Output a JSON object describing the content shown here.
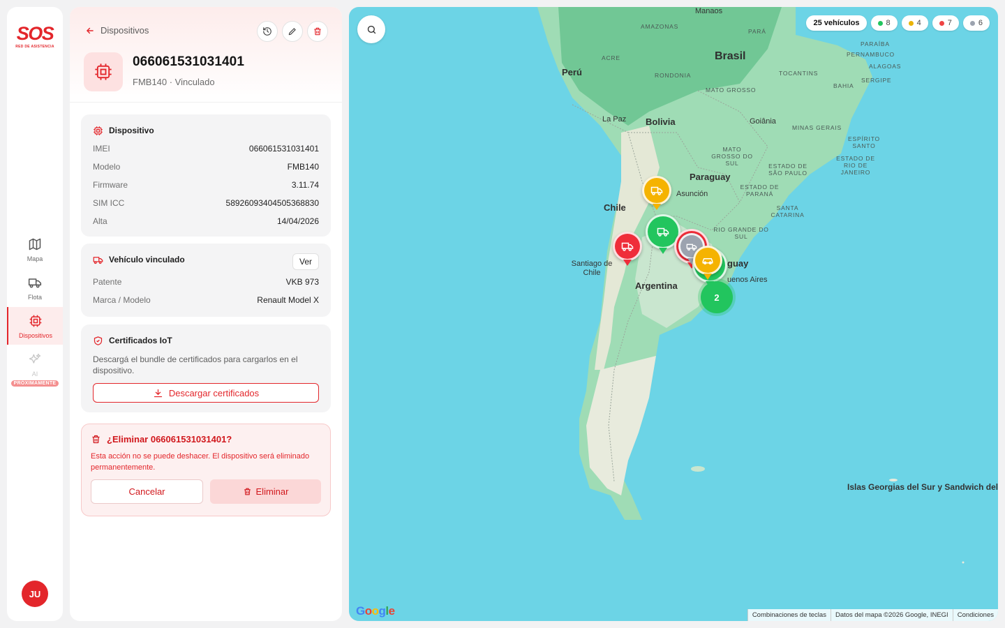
{
  "nav": {
    "logo": "SOS",
    "logo_sub": "RED DE ASISTENCIA",
    "items": [
      {
        "label": "Mapa"
      },
      {
        "label": "Flota"
      },
      {
        "label": "Dispositivos"
      },
      {
        "label": "AI",
        "badge": "PRÓXIMAMENTE"
      }
    ],
    "avatar": "JU"
  },
  "panel": {
    "back_label": "Dispositivos",
    "title": "066061531031401",
    "subtitle": "FMB140 · Vinculado",
    "device_card": {
      "title": "Dispositivo",
      "rows": [
        {
          "k": "IMEI",
          "v": "066061531031401"
        },
        {
          "k": "Modelo",
          "v": "FMB140"
        },
        {
          "k": "Firmware",
          "v": "3.11.74"
        },
        {
          "k": "SIM ICC",
          "v": "58926093404505368830"
        },
        {
          "k": "Alta",
          "v": "14/04/2026"
        }
      ]
    },
    "vehicle_card": {
      "title": "Vehículo vinculado",
      "button": "Ver",
      "rows": [
        {
          "k": "Patente",
          "v": "VKB 973"
        },
        {
          "k": "Marca / Modelo",
          "v": "Renault Model X"
        }
      ]
    },
    "cert_card": {
      "title": "Certificados IoT",
      "text": "Descargá el bundle de certificados para cargarlos en el dispositivo.",
      "button": "Descargar certificados"
    },
    "delete_confirm": {
      "title": "¿Eliminar 066061531031401?",
      "text": "Esta acción no se puede deshacer. El dispositivo será eliminado permanentemente.",
      "cancel": "Cancelar",
      "confirm": "Eliminar"
    }
  },
  "map": {
    "legend": {
      "total": "25 vehículos",
      "counts": [
        {
          "value": "8",
          "color": "#22c55e"
        },
        {
          "value": "4",
          "color": "#eab308"
        },
        {
          "value": "7",
          "color": "#ef4444"
        },
        {
          "value": "6",
          "color": "#9ca3af"
        }
      ]
    },
    "cluster_count": "2",
    "labels": {
      "manaos": "Manaos",
      "amazonas": "AMAZONAS",
      "para": "PARÁ",
      "paraiba": "PARAÍBA",
      "pernambuco": "PERNAMBUCO",
      "alagoas": "ALAGOAS",
      "sergipe": "SERGIPE",
      "bahia": "BAHIA",
      "acre": "ACRE",
      "brasil": "Brasil",
      "peru": "Perú",
      "rondonia": "RONDONIA",
      "tocantins": "TOCANTINS",
      "mato_grosso": "MATO GROSSO",
      "la_paz": "La Paz",
      "bolivia": "Bolivia",
      "goiania": "Goiânia",
      "minas": "MINAS GERAIS",
      "espirito": "ESPÍRITO SANTO",
      "mgs": "MATO GROSSO DO SUL",
      "sao_paulo": "ESTADO DE SÃO PAULO",
      "rio": "ESTADO DE RIO DE JANEIRO",
      "paraguay": "Paraguay",
      "asuncion": "Asunción",
      "parana": "ESTADO DE PARANÁ",
      "chile": "Chile",
      "santa_catarina": "SANTA CATARINA",
      "rio_grande": "RIO GRANDE DO SUL",
      "uruguay": "guay",
      "santiago": "Santiago de Chile",
      "buenos_aires": "uenos Aires",
      "argentina": "Argentina",
      "islas": "Islas Georgias del Sur y Sandwich del Sur"
    },
    "google": "Google",
    "attribution": [
      "Combinaciones de teclas",
      "Datos del mapa ©2026 Google, INEGI",
      "Condiciones"
    ]
  }
}
